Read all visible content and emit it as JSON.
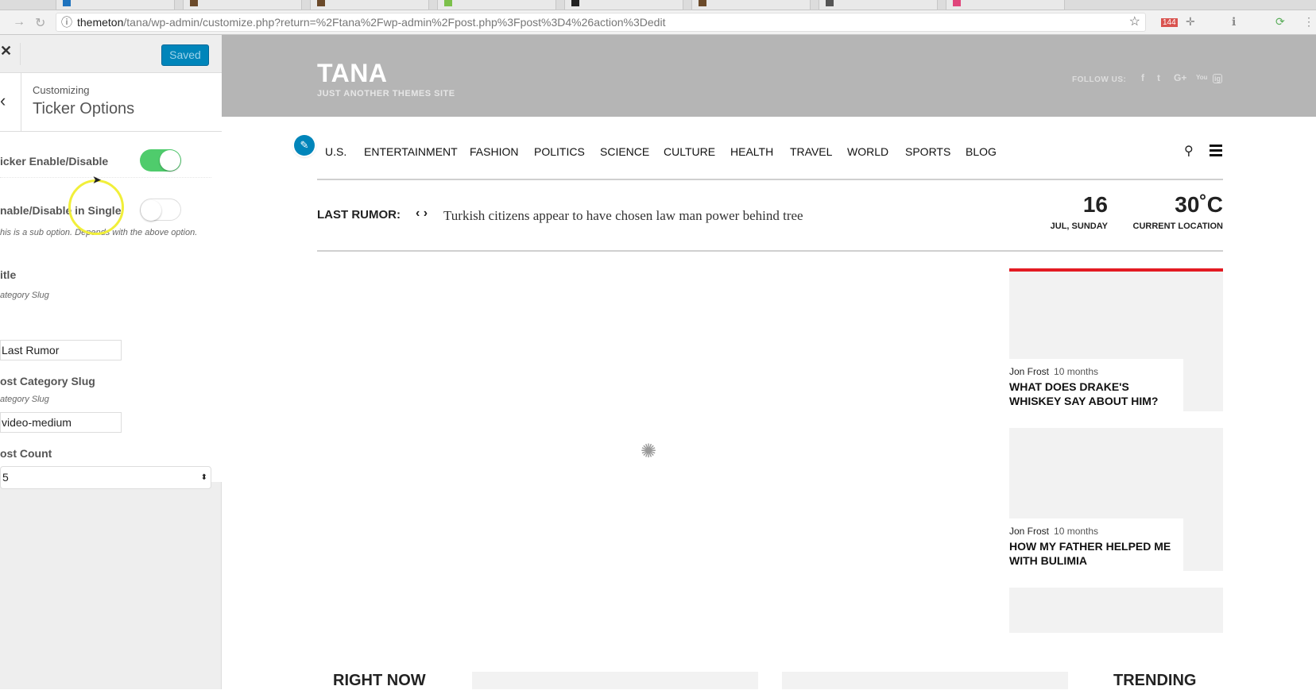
{
  "browser": {
    "url_host": "themeton",
    "url_path": "/tana/wp-admin/customize.php?return=%2Ftana%2Fwp-admin%2Fpost.php%3Fpost%3D4%26action%3Dedit",
    "mail_badge": "144"
  },
  "customizer": {
    "saved_label": "Saved",
    "customizing_label": "Customizing",
    "section_title": "Ticker Options",
    "ticker_enable_label": "icker Enable/Disable",
    "ticker_enable": true,
    "single_enable_label": "nable/Disable in Single",
    "single_enable": false,
    "sub_option_note": "his is a sub option. Depends with the above option.",
    "title_label": "itle",
    "title_desc": "ategory Slug",
    "title_value": "Last Rumor",
    "slug_label": "ost Category Slug",
    "slug_desc": "ategory Slug",
    "slug_value": "video-medium",
    "count_label": "ost Count",
    "count_value": "5"
  },
  "site": {
    "logo": "TANA",
    "tagline": "JUST ANOTHER THEMES SITE",
    "follow_label": "FOLLOW US:",
    "social": [
      "f",
      "t",
      "G+",
      "You",
      "ig"
    ],
    "nav": [
      "U.S.",
      "ENTERTAINMENT",
      "FASHION",
      "POLITICS",
      "SCIENCE",
      "CULTURE",
      "HEALTH",
      "TRAVEL",
      "WORLD",
      "SPORTS",
      "BLOG"
    ],
    "ticker": {
      "label": "LAST RUMOR:",
      "headline": "Turkish citizens appear to have chosen law man power behind tree"
    },
    "date": {
      "day": "16",
      "sub": "JUL, SUNDAY"
    },
    "weather": {
      "temp": "30˚C",
      "sub": "CURRENT LOCATION"
    },
    "posts": [
      {
        "author": "Jon Frost",
        "time": "10 months",
        "title": "WHAT DOES DRAKE'S WHISKEY SAY ABOUT HIM?"
      },
      {
        "author": "Jon Frost",
        "time": "10 months",
        "title": "HOW MY FATHER HELPED ME WITH BULIMIA"
      }
    ],
    "right_now": "RIGHT NOW",
    "trending": "TRENDING",
    "accent": "#e31b23"
  }
}
